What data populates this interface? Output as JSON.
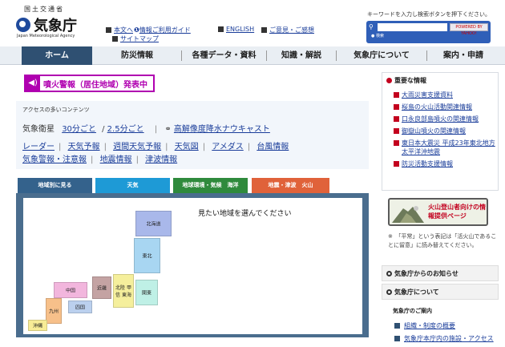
{
  "header": {
    "ministry": "国土交通省",
    "logo_text": "気象庁",
    "logo_sub": "Japan Meteorological Agency"
  },
  "utility_links": {
    "main_text": "本文へ",
    "info_guide": "情報ご利用ガイド",
    "english": "ENGLISH",
    "opinions": "ご意見・ご感想",
    "sitemap": "サイトマップ"
  },
  "search": {
    "note": "キーワードを入力し検索ボタンを押下ください。",
    "placeholder": "",
    "button": "POWERED BY YAHOO!",
    "radio": "● 検索"
  },
  "nav": {
    "items": [
      "ホーム",
      "防災情報",
      "各種データ・資料",
      "知識・解説",
      "気象庁について",
      "案内・申請"
    ]
  },
  "alert": {
    "icon": "◀)",
    "text": "噴火警報（居住地域）発表中"
  },
  "popular": {
    "title": "アクセスの多いコンテンツ",
    "satellite_label": "気象衛星",
    "every30": "30分ごと",
    "slash": "/",
    "every2_5": "2.5分ごと",
    "nowcast": "高解像度降水ナウキャスト",
    "links_row2": [
      "レーダー",
      "天気予報",
      "週間天気予報",
      "天気図",
      "アメダス",
      "台風情報"
    ],
    "links_row3": [
      "気象警報・注意報",
      "地震情報",
      "津波情報"
    ]
  },
  "tabs": {
    "items": [
      "地域別に見る",
      "天気",
      "地球環境・気候　海洋",
      "地震・津波　火山"
    ]
  },
  "map": {
    "prompt": "見たい地域を選んでください",
    "regions": [
      "北海道",
      "東北",
      "北陸 甲信 東海",
      "関東",
      "近畿",
      "中国",
      "四国",
      "九州",
      "沖縄"
    ]
  },
  "sidebar": {
    "important_title": "重要な情報",
    "important_items": [
      "大雨災害支援資料",
      "桜島の火山活動関連情報",
      "口永良部島噴火の関連情報",
      "御嶽山噴火の関連情報",
      "東日本大震災 平成23年東北地方太平洋沖地震",
      "防災活動支援情報"
    ],
    "volcano_banner": "火山登山者向けの情報提供ページ",
    "volcano_note": "※　「平常」という表記は「活火山であることに留意」に読み替えてください。",
    "notice_title": "気象庁からのお知らせ",
    "about_title": "気象庁について",
    "guide_title": "気象庁のご案内",
    "guide_items": [
      "組織・制度の概要",
      "気象庁本庁内の施設・アクセス"
    ]
  },
  "colors": {
    "nav_home": "#2f5072",
    "alert": "#b000b0",
    "tab_region": "#34628c",
    "tab_weather": "#1e9ad6",
    "tab_climate": "#2f8a3c",
    "tab_quake": "#e0623a",
    "important_red": "#c3001e"
  }
}
